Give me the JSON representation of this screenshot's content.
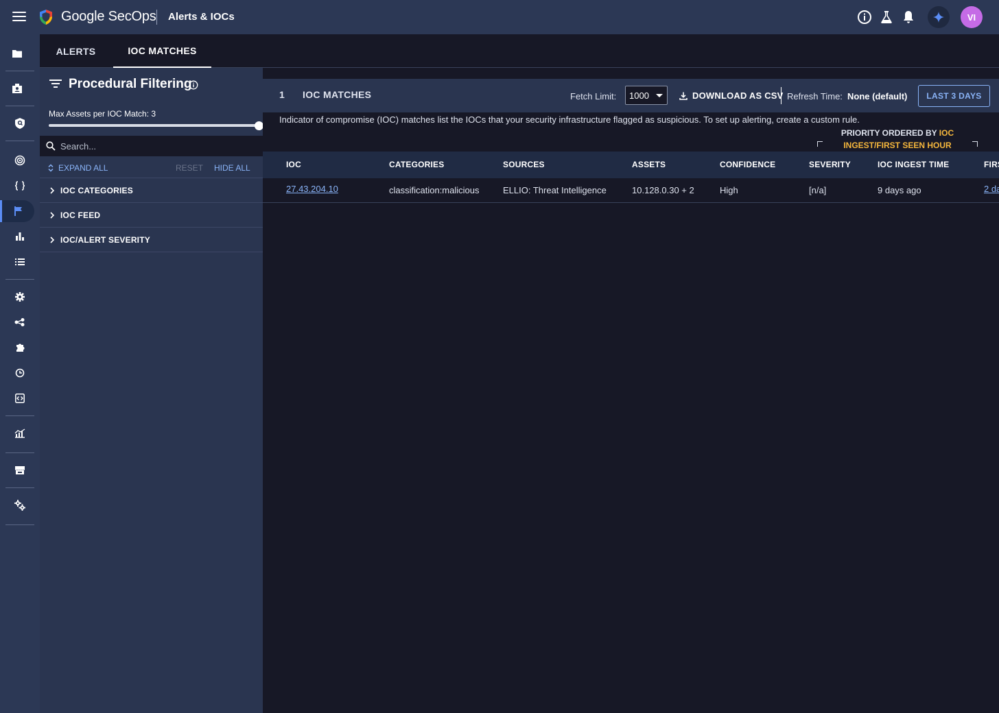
{
  "header": {
    "brand": "Google SecOps",
    "app_title": "Alerts & IOCs",
    "avatar_initials": "VI",
    "accent": "#5b8df5",
    "avatar_color": "#c56be6"
  },
  "tabs": [
    {
      "label": "ALERTS",
      "active": false
    },
    {
      "label": "IOC MATCHES",
      "active": true
    }
  ],
  "filter_panel": {
    "title": "Procedural Filtering",
    "max_assets_label": "Max Assets per IOC Match: 3",
    "slider_value_fraction": 1.0,
    "search_placeholder": "Search...",
    "expand_all": "EXPAND ALL",
    "reset": "RESET",
    "hide_all": "HIDE ALL",
    "sections": [
      "IOC CATEGORIES",
      "IOC FEED",
      "IOC/ALERT SEVERITY"
    ]
  },
  "main": {
    "match_count": "1",
    "match_title": "IOC MATCHES",
    "fetch_label": "Fetch Limit:",
    "fetch_value": "1000",
    "download_label": "DOWNLOAD AS CSV",
    "refresh_label": "Refresh Time:",
    "refresh_value": "None (default)",
    "range_button": "LAST 3 DAYS",
    "description": "Indicator of compromise (IOC) matches list the IOCs that your security infrastructure flagged as suspicious. To set up alerting, create a custom rule.",
    "priority_prefix": "PRIORITY ORDERED BY ",
    "priority_highlight_1": "IOC",
    "priority_highlight_2": "INGEST/FIRST SEEN HOUR",
    "priority_color": "#f6b73c"
  },
  "table": {
    "columns": [
      "IOC",
      "CATEGORIES",
      "SOURCES",
      "ASSETS",
      "CONFIDENCE",
      "SEVERITY",
      "IOC INGEST TIME",
      "FIRS"
    ],
    "rows": [
      {
        "ioc": "27.43.204.10",
        "categories": "classification:malicious",
        "sources": "ELLIO: Threat Intelligence",
        "assets": "10.128.0.30 + 2",
        "confidence": "High",
        "severity": "[n/a]",
        "ingest_time": "9 days ago",
        "first_seen": "2 da"
      }
    ]
  }
}
